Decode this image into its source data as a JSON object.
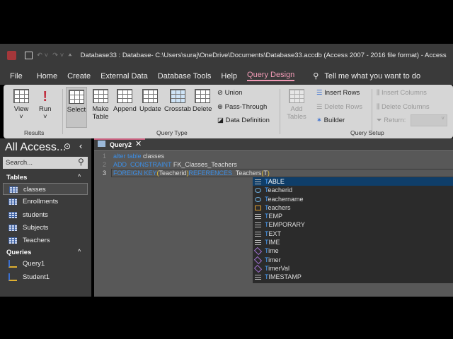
{
  "titlebar": {
    "app_icon": "A",
    "title": "Database33 : Database- C:\\Users\\suraj\\OneDrive\\Documents\\Database33.accdb (Access 2007 - 2016 file format)  -  Access"
  },
  "tabs": [
    "File",
    "Home",
    "Create",
    "External Data",
    "Database Tools",
    "Help",
    "Query Design"
  ],
  "tell_me": "Tell me what you want to do",
  "ribbon": {
    "results": {
      "view": "View",
      "run": "Run",
      "label": "Results"
    },
    "query_type": {
      "select": "Select",
      "make_table": "Make Table",
      "append": "Append",
      "update": "Update",
      "crosstab": "Crosstab",
      "delete": "Delete",
      "union": "Union",
      "pass_through": "Pass-Through",
      "data_definition": "Data Definition",
      "label": "Query Type"
    },
    "query_setup": {
      "add_tables": "Add Tables",
      "insert_rows": "Insert Rows",
      "delete_rows": "Delete Rows",
      "builder": "Builder",
      "insert_columns": "Insert Columns",
      "delete_columns": "Delete Columns",
      "return": "Return:",
      "label": "Query Setup"
    }
  },
  "nav": {
    "title": "All Access...",
    "search_placeholder": "Search...",
    "tables_label": "Tables",
    "tables": [
      "classes",
      "Enrollments",
      "students",
      "Subjects",
      "Teachers"
    ],
    "queries_label": "Queries",
    "queries": [
      "Query1",
      "Student1"
    ]
  },
  "editor": {
    "tab": "Query2",
    "lines": [
      {
        "n": "1",
        "a": "alter table",
        "b": " classes"
      },
      {
        "n": "2",
        "a": "ADD  CONSTRAINT",
        "b": " FK_Classes_Teachers"
      },
      {
        "n": "3",
        "a": "FOREIGN KEY",
        "p1": "(",
        "c": "Teacherid",
        "p2": ")",
        "d": "REFERENCES",
        "e": "  Teachers",
        "p3": "(",
        "f": "T",
        "p4": ")"
      }
    ]
  },
  "autocomplete": [
    {
      "t": "T",
      "r": "ABLE",
      "type": "kw"
    },
    {
      "t": "T",
      "r": "eacherid",
      "type": "col"
    },
    {
      "t": "T",
      "r": "eachername",
      "type": "col"
    },
    {
      "t": "T",
      "r": "eachers",
      "type": "tbl"
    },
    {
      "t": "T",
      "r": "EMP",
      "type": "kw"
    },
    {
      "t": "T",
      "r": "EMPORARY",
      "type": "kw"
    },
    {
      "t": "T",
      "r": "EXT",
      "type": "kw"
    },
    {
      "t": "T",
      "r": "IME",
      "type": "kw"
    },
    {
      "t": "T",
      "r": "ime",
      "type": "fn"
    },
    {
      "t": "T",
      "r": "imer",
      "type": "fn"
    },
    {
      "t": "T",
      "r": "imerVal",
      "type": "fn"
    },
    {
      "t": "T",
      "r": "IMESTAMP",
      "type": "kw"
    }
  ]
}
